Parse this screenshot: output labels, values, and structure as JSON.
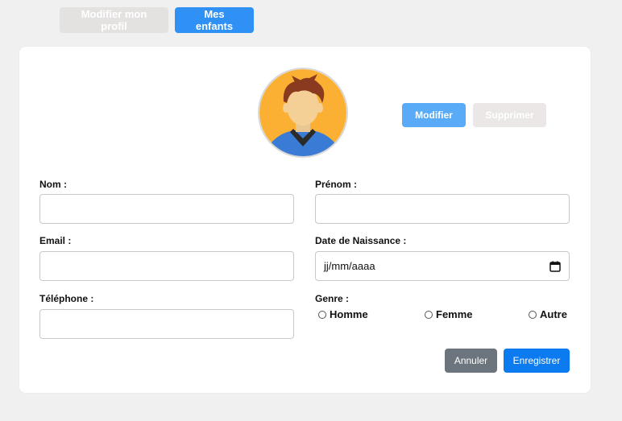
{
  "tabs": {
    "profile_label": "Modifier mon profil",
    "children_label": "Mes enfants"
  },
  "photo": {
    "modify_label": "Modifier",
    "delete_label": "Supprimer"
  },
  "form": {
    "nom_label": "Nom :",
    "prenom_label": "Prénom :",
    "email_label": "Email :",
    "birthdate_label": "Date de Naissance :",
    "birthdate_placeholder": "jj/mm/aaaa",
    "phone_label": "Téléphone :",
    "gender_label": "Genre :",
    "gender_options": [
      "Homme",
      "Femme",
      "Autre"
    ],
    "cancel_label": "Annuler",
    "save_label": "Enregistrer"
  },
  "colors": {
    "primary": "#2f90f5",
    "secondary": "#6c757d",
    "disabled": "#e4e1e1",
    "avatar_bg": "#fbb034"
  },
  "icons": {
    "avatar": "user-avatar-icon",
    "calendar": "calendar-icon"
  }
}
